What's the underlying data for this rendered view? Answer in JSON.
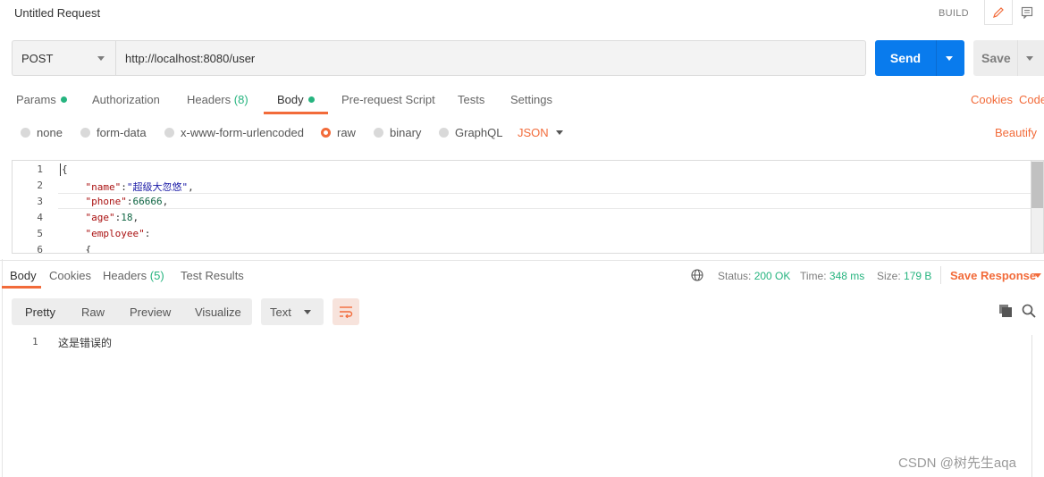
{
  "window": {
    "title": "Untitled Request",
    "build_label": "BUILD"
  },
  "request": {
    "method": "POST",
    "url": "http://localhost:8080/user",
    "send_label": "Send",
    "save_label": "Save"
  },
  "request_tabs": {
    "params": "Params",
    "authorization": "Authorization",
    "headers": "Headers",
    "headers_count": "(8)",
    "body": "Body",
    "prerequest": "Pre-request Script",
    "tests": "Tests",
    "settings": "Settings",
    "cookies": "Cookies",
    "code": "Code"
  },
  "body_types": {
    "none": "none",
    "form_data": "form-data",
    "urlencoded": "x-www-form-urlencoded",
    "raw": "raw",
    "binary": "binary",
    "graphql": "GraphQL",
    "format": "JSON",
    "beautify": "Beautify",
    "selected": "raw"
  },
  "editor": {
    "line_numbers": [
      "1",
      "2",
      "3",
      "4",
      "5",
      "6"
    ],
    "lines": {
      "l1": "{",
      "l2_key": "\"name\"",
      "l2_val": "\"超级大忽悠\"",
      "l3_key": "\"phone\"",
      "l3_val": "66666",
      "l4_key": "\"age\"",
      "l4_val": "18",
      "l5_key": "\"employee\"",
      "l6": "{"
    }
  },
  "response_tabs": {
    "body": "Body",
    "cookies": "Cookies",
    "headers": "Headers",
    "headers_count": "(5)",
    "test_results": "Test Results"
  },
  "response_meta": {
    "status_label": "Status:",
    "status_value": "200 OK",
    "time_label": "Time:",
    "time_value": "348 ms",
    "size_label": "Size:",
    "size_value": "179 B",
    "save_response": "Save Response"
  },
  "response_view": {
    "pretty": "Pretty",
    "raw": "Raw",
    "preview": "Preview",
    "visualize": "Visualize",
    "format": "Text",
    "line_number": "1",
    "content": "这是错误的"
  },
  "watermark": "CSDN @树先生aqa",
  "colors": {
    "accent": "#f26b3a",
    "send": "#097bed",
    "success": "#26b47f"
  }
}
